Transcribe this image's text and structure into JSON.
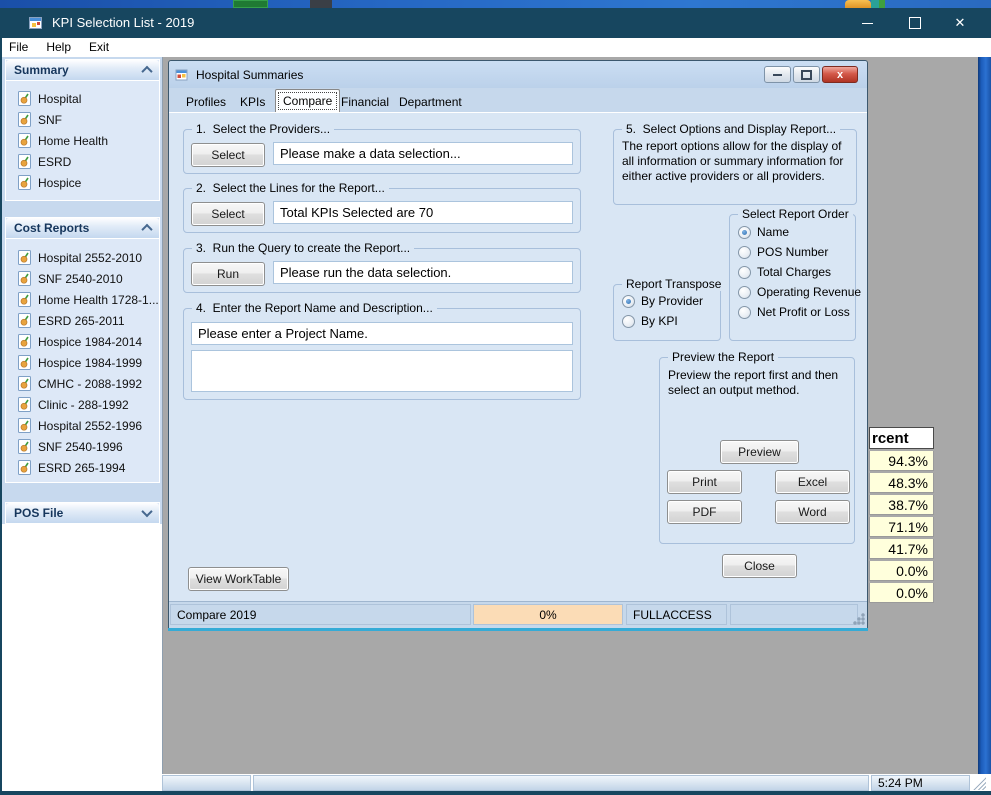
{
  "desktop": {
    "time": "5:24 PM"
  },
  "app": {
    "title": "KPI Selection List - 2019",
    "menu": {
      "items": [
        "File",
        "Help",
        "Exit"
      ]
    }
  },
  "sidebar": {
    "sections": [
      {
        "title": "Summary",
        "state": "expanded",
        "items": [
          "Hospital",
          "SNF",
          "Home Health",
          "ESRD",
          "Hospice"
        ]
      },
      {
        "title": "Cost Reports",
        "state": "expanded",
        "items": [
          "Hospital 2552-2010",
          "SNF 2540-2010",
          "Home Health 1728-1...",
          "ESRD 265-2011",
          "Hospice 1984-2014",
          "Hospice 1984-1999",
          "CMHC - 2088-1992",
          "Clinic - 288-1992",
          "Hospital 2552-1996",
          "SNF 2540-1996",
          "ESRD 265-1994"
        ]
      },
      {
        "title": "POS File",
        "state": "collapsed",
        "items": []
      }
    ]
  },
  "child": {
    "title": "Hospital Summaries",
    "tabs": [
      "Profiles",
      "KPIs",
      "Compare",
      "Financial",
      "Department"
    ],
    "active_tab": "Compare",
    "step1": {
      "label": "1.  Select the Providers...",
      "button": "Select",
      "value": "Please make a data selection..."
    },
    "step2": {
      "label": "2.  Select the Lines for the Report...",
      "button": "Select",
      "value": "Total KPIs Selected are 70"
    },
    "step3": {
      "label": "3.  Run the Query to create the Report...",
      "button": "Run",
      "value": "Please run the data selection."
    },
    "step4": {
      "label": "4.  Enter the Report Name and Description...",
      "name_value": "Please enter a Project Name.",
      "description_value": ""
    },
    "step5": {
      "label": "5.  Select Options and Display Report...",
      "text": "The report options allow for the display of all information or summary information for either active providers or all providers."
    },
    "transpose": {
      "label": "Report Transpose",
      "options": [
        {
          "label": "By Provider",
          "selected": true
        },
        {
          "label": "By KPI",
          "selected": false
        }
      ]
    },
    "report_order": {
      "label": "Select Report Order",
      "options": [
        {
          "label": "Name",
          "selected": true
        },
        {
          "label": "POS Number",
          "selected": false
        },
        {
          "label": "Total Charges",
          "selected": false
        },
        {
          "label": "Operating Revenue",
          "selected": false
        },
        {
          "label": "Net Profit or Loss",
          "selected": false
        }
      ]
    },
    "preview": {
      "label": "Preview the Report",
      "text": "Preview the report first and then select an output method.",
      "preview_button": "Preview",
      "print_button": "Print",
      "excel_button": "Excel",
      "pdf_button": "PDF",
      "word_button": "Word"
    },
    "worktable_button": "View WorkTable",
    "close_button": "Close",
    "statusbar": {
      "context": "Compare 2019",
      "progress": "0%",
      "access": "FULLACCESS"
    }
  },
  "background_table": {
    "header": "rcent",
    "rows": [
      "94.3%",
      "48.3%",
      "38.7%",
      "71.1%",
      "41.7%",
      "0.0%",
      "0.0%"
    ]
  },
  "icons": {
    "close_glyph": "✕",
    "child_close_glyph": "x"
  },
  "colors": {
    "titlebar_teal": "#17465F",
    "progress_peach": "#FBDCB6",
    "table_cell_yellow": "#FFFFDC",
    "accent_cyan": "#35ABD6"
  }
}
